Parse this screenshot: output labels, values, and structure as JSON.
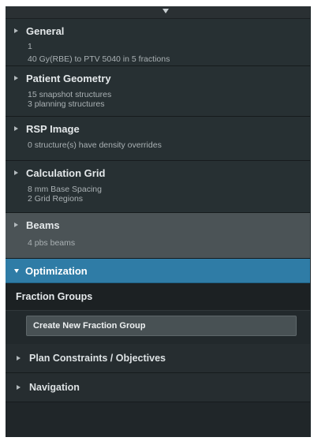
{
  "sections": [
    {
      "title": "General",
      "lines": [
        "1",
        "40 Gy(RBE) to PTV 5040 in 5 fractions"
      ]
    },
    {
      "title": "Patient Geometry",
      "lines": [
        "15 snapshot structures",
        "3 planning structures"
      ]
    },
    {
      "title": "RSP Image",
      "lines": [
        "0 structure(s) have density overrides"
      ]
    },
    {
      "title": "Calculation Grid",
      "lines": [
        "8 mm Base Spacing",
        "2 Grid Regions"
      ]
    },
    {
      "title": "Beams",
      "lines": [
        "4 pbs beams"
      ]
    }
  ],
  "optimization": {
    "title": "Optimization",
    "fraction_groups_title": "Fraction Groups",
    "create_button_label": "Create New Fraction Group"
  },
  "subsections": [
    {
      "title": "Plan Constraints / Objectives"
    },
    {
      "title": "Navigation"
    }
  ]
}
